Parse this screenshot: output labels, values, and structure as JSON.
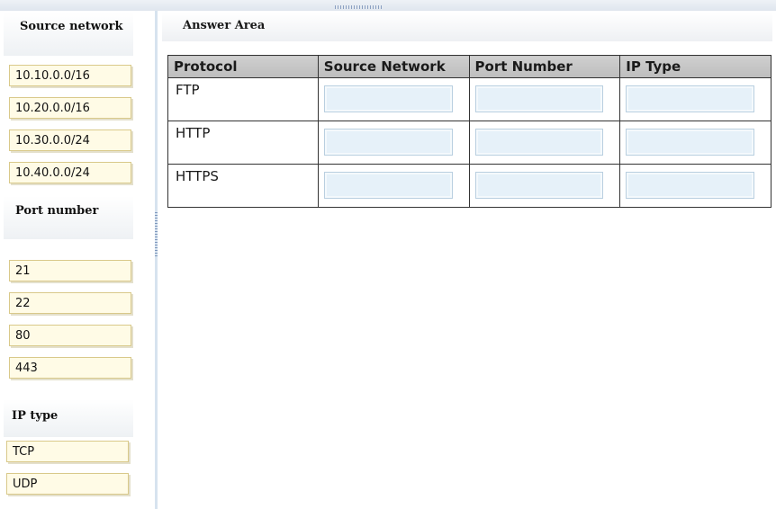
{
  "left_panel": {
    "source_network": {
      "header": "Source network",
      "items": [
        "10.10.0.0/16",
        "10.20.0.0/16",
        "10.30.0.0/24",
        "10.40.0.0/24"
      ]
    },
    "port_number": {
      "header": "Port number",
      "items": [
        "21",
        "22",
        "80",
        "443"
      ]
    },
    "ip_type": {
      "header": "IP type",
      "items": [
        "TCP",
        "UDP"
      ]
    }
  },
  "answer_area": {
    "title": "Answer Area",
    "columns": [
      "Protocol",
      "Source Network",
      "Port Number",
      "IP Type"
    ],
    "rows": [
      {
        "protocol": "FTP",
        "source_network": "",
        "port_number": "",
        "ip_type": ""
      },
      {
        "protocol": "HTTP",
        "source_network": "",
        "port_number": "",
        "ip_type": ""
      },
      {
        "protocol": "HTTPS",
        "source_network": "",
        "port_number": "",
        "ip_type": ""
      }
    ]
  },
  "colors": {
    "chip_bg": "#fffbe6",
    "drop_zone_bg": "#e6f1f9",
    "header_bg": "#c8c8c8"
  }
}
